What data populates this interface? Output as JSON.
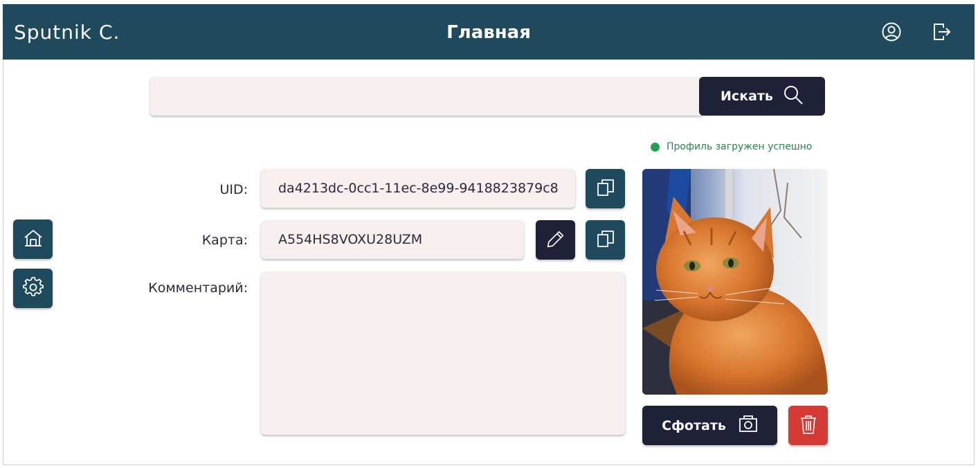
{
  "header": {
    "brand": "Sputnik C.",
    "title": "Главная",
    "profile_icon": "user-circle-icon",
    "logout_icon": "logout-icon"
  },
  "search": {
    "value": "",
    "button_label": "Искать",
    "button_icon": "search-icon"
  },
  "status": {
    "text": "Профиль загружен успешно",
    "color": "#24a050"
  },
  "form": {
    "uid_label": "UID:",
    "uid_value": "da4213dc-0cc1-11ec-8e99-9418823879c8",
    "card_label": "Карта:",
    "card_value": "A554HS8VOXU28UZM",
    "comment_label": "Комментарий:",
    "comment_value": ""
  },
  "sidebar": {
    "items": [
      {
        "icon": "home-icon"
      },
      {
        "icon": "gear-icon"
      }
    ]
  },
  "photo": {
    "description_icon": "cat-photo"
  },
  "actions": {
    "snap_label": "Сфотать",
    "snap_icon": "camera-icon",
    "delete_icon": "trash-icon"
  },
  "colors": {
    "header": "#1f4a5e",
    "primary_dark": "#1e2138",
    "field_bg": "#f7efed",
    "danger": "#d63a35"
  }
}
